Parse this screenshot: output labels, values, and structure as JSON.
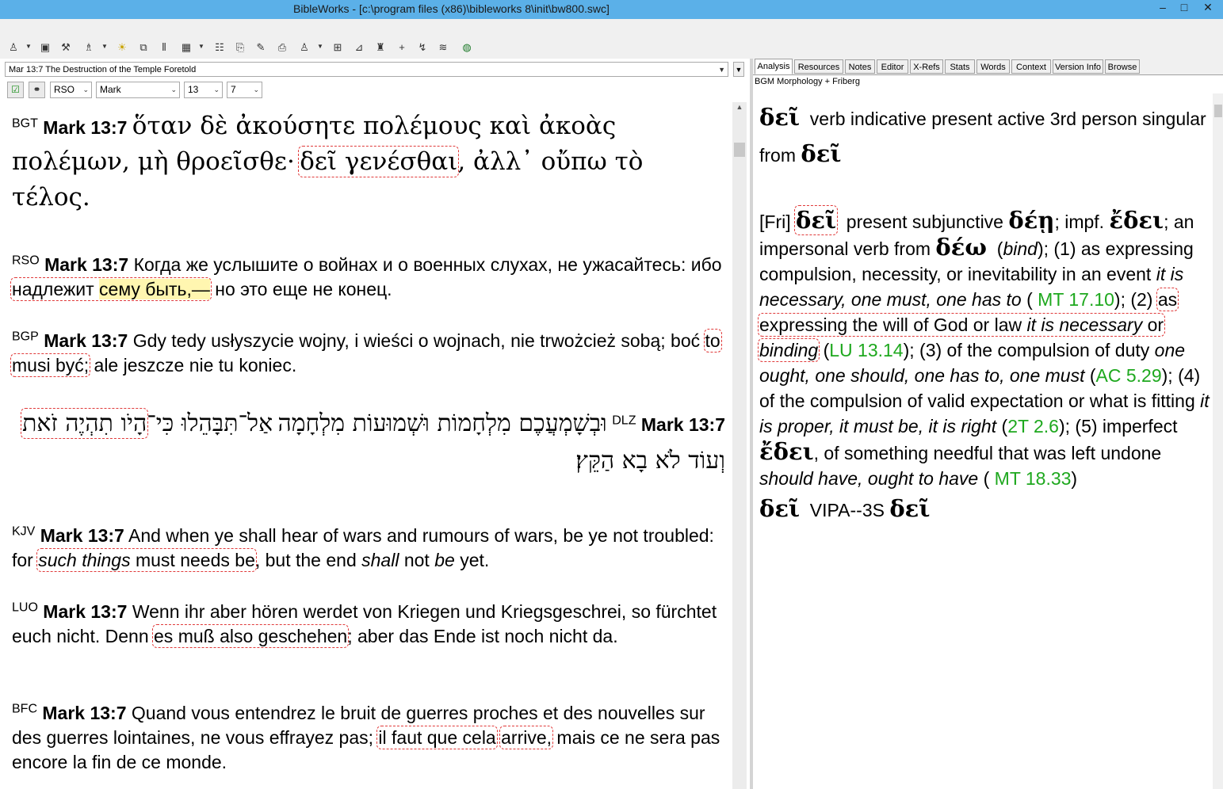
{
  "window": {
    "title": "BibleWorks - [c:\\program files (x86)\\bibleworks 8\\init\\bw800.swc]",
    "minimize": "–",
    "maximize": "□",
    "close": "✕"
  },
  "left": {
    "reference_combo": "Mar 13:7 The Destruction of the Temple Foretold",
    "version_select": "RSO",
    "book_select": "Mark",
    "chapter_select": "13",
    "verse_select": "7"
  },
  "verses": {
    "bgt": {
      "sig": "BGT",
      "ref": "Mark 13:7",
      "t1": "ὅταν δὲ ἀκούσητε πολέμους καὶ ἀκοὰς πολέμων, μὴ θροεῖσθε·",
      "h1": "δεῖ γενέσθαι",
      "t2": ", ἀλλ᾽ οὔπω τὸ τέλος."
    },
    "rso": {
      "sig": "RSO",
      "ref": "Mark 13:7",
      "t1": "Когда же услышите о войнах и о военных слухах, не ужасайтесь: ибо",
      "h1": "надлежит",
      "h2": "сему быть,",
      "h3": "—",
      "t2": "но это еще не конец."
    },
    "bgp": {
      "sig": "BGP",
      "ref": "Mark 13:7",
      "t1": "Gdy tedy usłyszycie wojny, i wieści o wojnach, nie trwożcież sobą; boć",
      "h1": "to musi być;",
      "t2": "ale jeszcze nie tu koniec."
    },
    "dlz": {
      "sig": "DLZ",
      "ref": "Mark 13:7",
      "line1": "וּבְשָׁמְעֲכֶם מִלְחָמוֹת וּשְׁמוּעוֹת מִלְחָמָה",
      "t1": "אַל־תִּבָּהֵלוּ כִּי־",
      "h1": "הָיֹו תִהְיֶה זֹאת",
      "t2": "וְעוֹד לֹא בָא הַקֵּץ׃"
    },
    "kjv": {
      "sig": "KJV",
      "ref": "Mark 13:7",
      "t1": "And when ye shall hear of wars and rumours of wars, be ye not troubled: for",
      "h1i": "such things",
      "h1": "must needs be",
      "t2a": ", but the end",
      "i2": "shall",
      "t2b": "not",
      "i3": "be",
      "t2c": "yet."
    },
    "luo": {
      "sig": "LUO",
      "ref": "Mark 13:7",
      "t1": "Wenn ihr aber hören werdet von Kriegen und Kriegsgeschrei, so fürchtet euch nicht. Denn",
      "h1": "es muß also geschehen",
      "t2": "; aber das Ende ist noch nicht da."
    },
    "bfc": {
      "sig": "BFC",
      "ref": "Mark 13:7",
      "t1": "Quand vous entendrez le bruit de guerres proches et des nouvelles sur des guerres lointaines, ne vous effrayez pas;",
      "h1a": "il faut que cela",
      "h1b": "arrive,",
      "t2": "mais ce ne sera pas encore la fin de ce monde."
    }
  },
  "tabs": [
    "Analysis",
    "Resources",
    "Notes",
    "Editor",
    "X-Refs",
    "Stats",
    "Words",
    "Context",
    "Version Info",
    "Browse"
  ],
  "analysis": {
    "caption": "BGM Morphology + Friberg",
    "word": "δεῖ",
    "parse_text": "verb indicative present active 3rd person singular from",
    "fri_tag": "[Fri]",
    "fri_word": "δεῖ",
    "s1": "present subjunctive",
    "g1": "δέῃ",
    "s2": "; impf.",
    "g2": "ἔδει",
    "s3": "; an impersonal verb from",
    "g3": "δέω",
    "s4": "(",
    "i1": "bind",
    "s5": "); (1) as expressing compulsion, necessity, or inevitability in an event",
    "i2": "it is necessary, one must, one has to",
    "s6": "(",
    "ref1": "MT 17.10",
    "s7": "); (2)",
    "h1": "as expressing the will of God or law",
    "i3": "it is necessary",
    "h2": "or",
    "i4": "binding",
    "s8": "(",
    "ref2": "LU 13.14",
    "s9": "); (3) of the compulsion of duty",
    "i5": "one ought, one should, one has to, one must",
    "s10": "(",
    "ref3": "AC 5.29",
    "s11": "); (4) of the compulsion of valid expectation or what is fitting",
    "i6": "it is proper, it must be, it is right",
    "s12": "(",
    "ref4": "2T 2.6",
    "s13": "); (5) imperfect",
    "g4": "ἔδει",
    "s14": ", of something needful that was left undone",
    "i7": "should have, ought to have",
    "s15": "(",
    "ref5": "MT 18.33",
    "s16": ")",
    "code_word": "δεῖ",
    "code": "VIPA--3S",
    "code_lemma": "δεῖ"
  },
  "colors": {
    "titlebar": "#5bb0e8",
    "link": "#1ea81e",
    "highlight_border": "#e03a3a",
    "highlight_fill": "#fff6b0"
  }
}
